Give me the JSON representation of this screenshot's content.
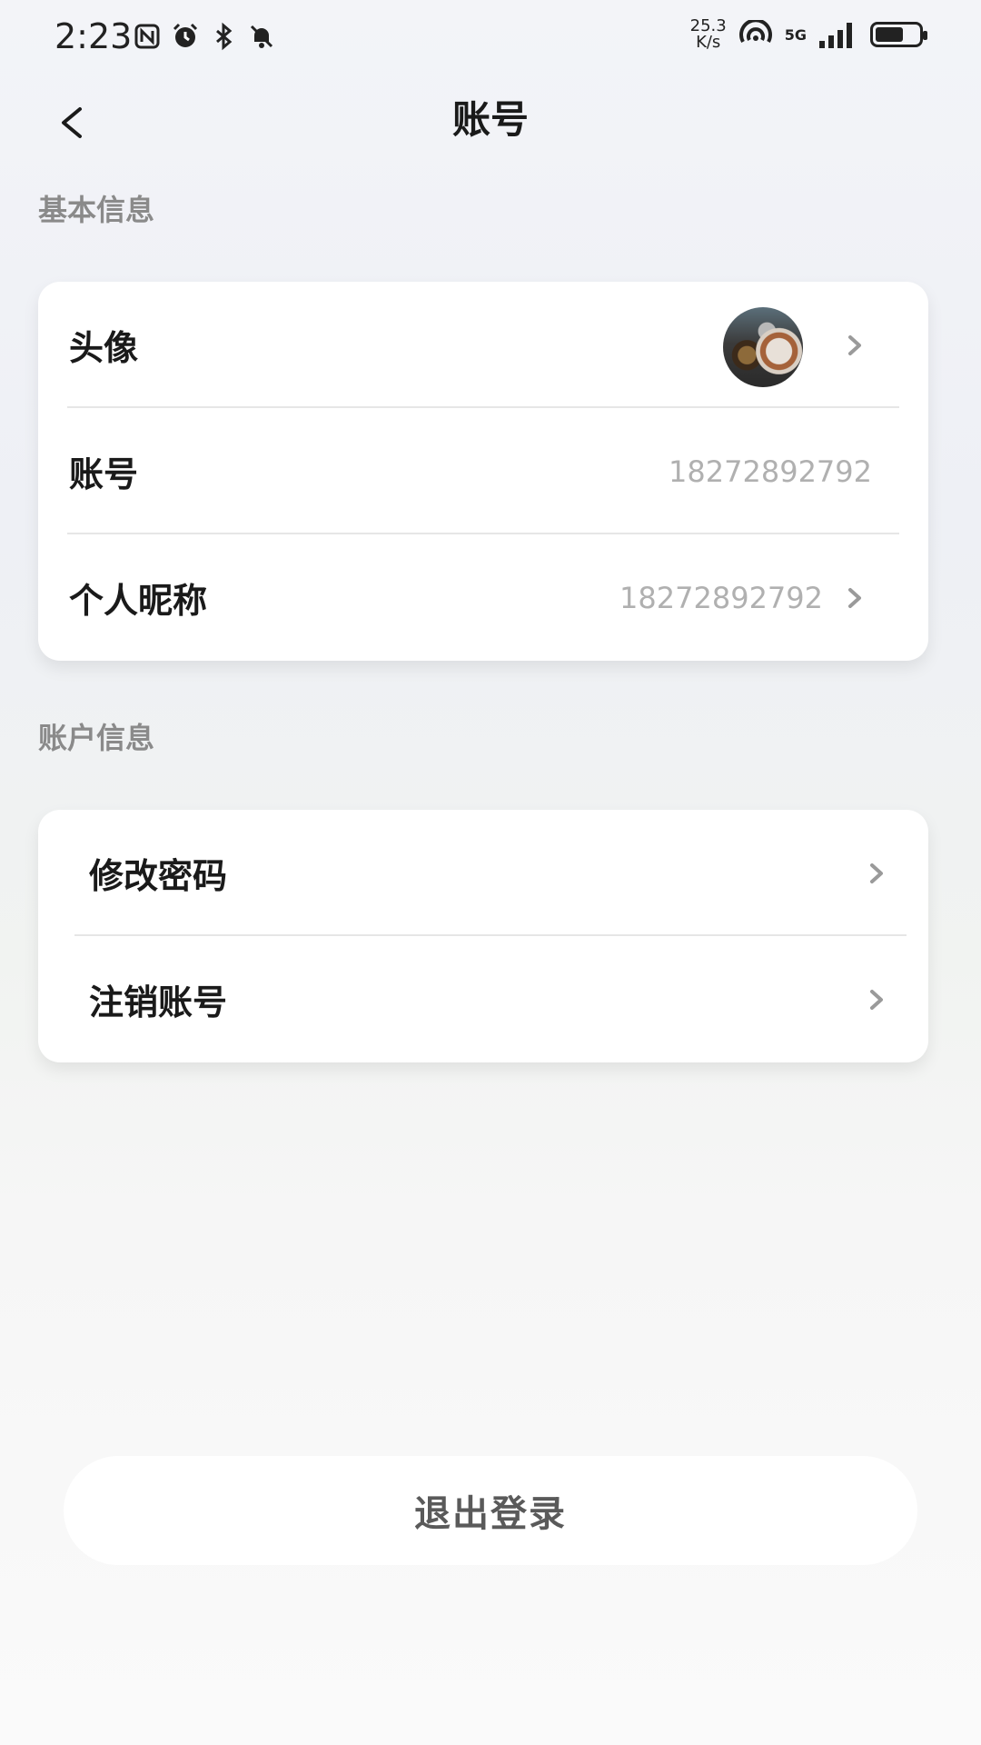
{
  "status_bar": {
    "time": "2:23",
    "net_speed_value": "25.3",
    "net_speed_unit": "K/s",
    "network": "5G",
    "battery_level": 0.65
  },
  "nav": {
    "title": "账号"
  },
  "basic_info": {
    "section_label": "基本信息",
    "avatar_label": "头像",
    "account_label": "账号",
    "account_value": "18272892792",
    "nickname_label": "个人昵称",
    "nickname_value": "18272892792"
  },
  "account_info": {
    "section_label": "账户信息",
    "change_password_label": "修改密码",
    "delete_account_label": "注销账号"
  },
  "logout": {
    "label": "退出登录"
  }
}
